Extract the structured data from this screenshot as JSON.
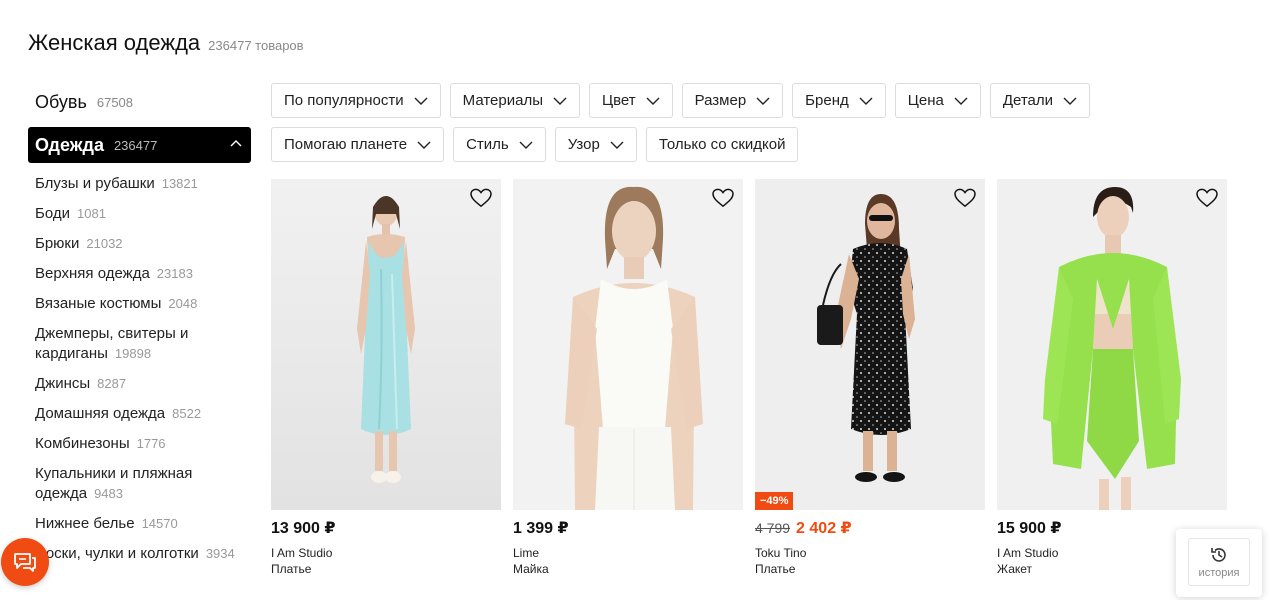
{
  "header": {
    "title": "Женская одежда",
    "count": "236477 товаров"
  },
  "sidebar": {
    "top_categories": [
      {
        "label": "Обувь",
        "count": "67508"
      },
      {
        "label": "Одежда",
        "count": "236477"
      }
    ],
    "subcategories": [
      {
        "label": "Блузы и рубашки",
        "count": "13821"
      },
      {
        "label": "Боди",
        "count": "1081"
      },
      {
        "label": "Брюки",
        "count": "21032"
      },
      {
        "label": "Верхняя одежда",
        "count": "23183"
      },
      {
        "label": "Вязаные костюмы",
        "count": "2048"
      },
      {
        "label": "Джемперы, свитеры и кардиганы",
        "count": "19898"
      },
      {
        "label": "Джинсы",
        "count": "8287"
      },
      {
        "label": "Домашняя одежда",
        "count": "8522"
      },
      {
        "label": "Комбинезоны",
        "count": "1776"
      },
      {
        "label": "Купальники и пляжная одежда",
        "count": "9483"
      },
      {
        "label": "Нижнее белье",
        "count": "14570"
      },
      {
        "label": "Носки, чулки и колготки",
        "count": "3934"
      }
    ]
  },
  "filters": {
    "row1": [
      "По популярности",
      "Материалы",
      "Цвет",
      "Размер",
      "Бренд",
      "Цена",
      "Детали"
    ],
    "row2": [
      "Помогаю планете",
      "Стиль",
      "Узор"
    ],
    "discount_only": "Только со скидкой"
  },
  "products": [
    {
      "price": "13 900 ₽",
      "brand": "I Am Studio",
      "type": "Платье"
    },
    {
      "price": "1 399 ₽",
      "brand": "Lime",
      "type": "Майка"
    },
    {
      "old_price": "4 799",
      "price": "2 402 ₽",
      "discount": "−49%",
      "brand": "Toku Tino",
      "type": "Платье"
    },
    {
      "price": "15 900 ₽",
      "brand": "I Am Studio",
      "type": "Жакет"
    }
  ],
  "history": {
    "label": "история"
  },
  "colors": {
    "accent": "#f04b12",
    "active_bg": "#000000"
  }
}
